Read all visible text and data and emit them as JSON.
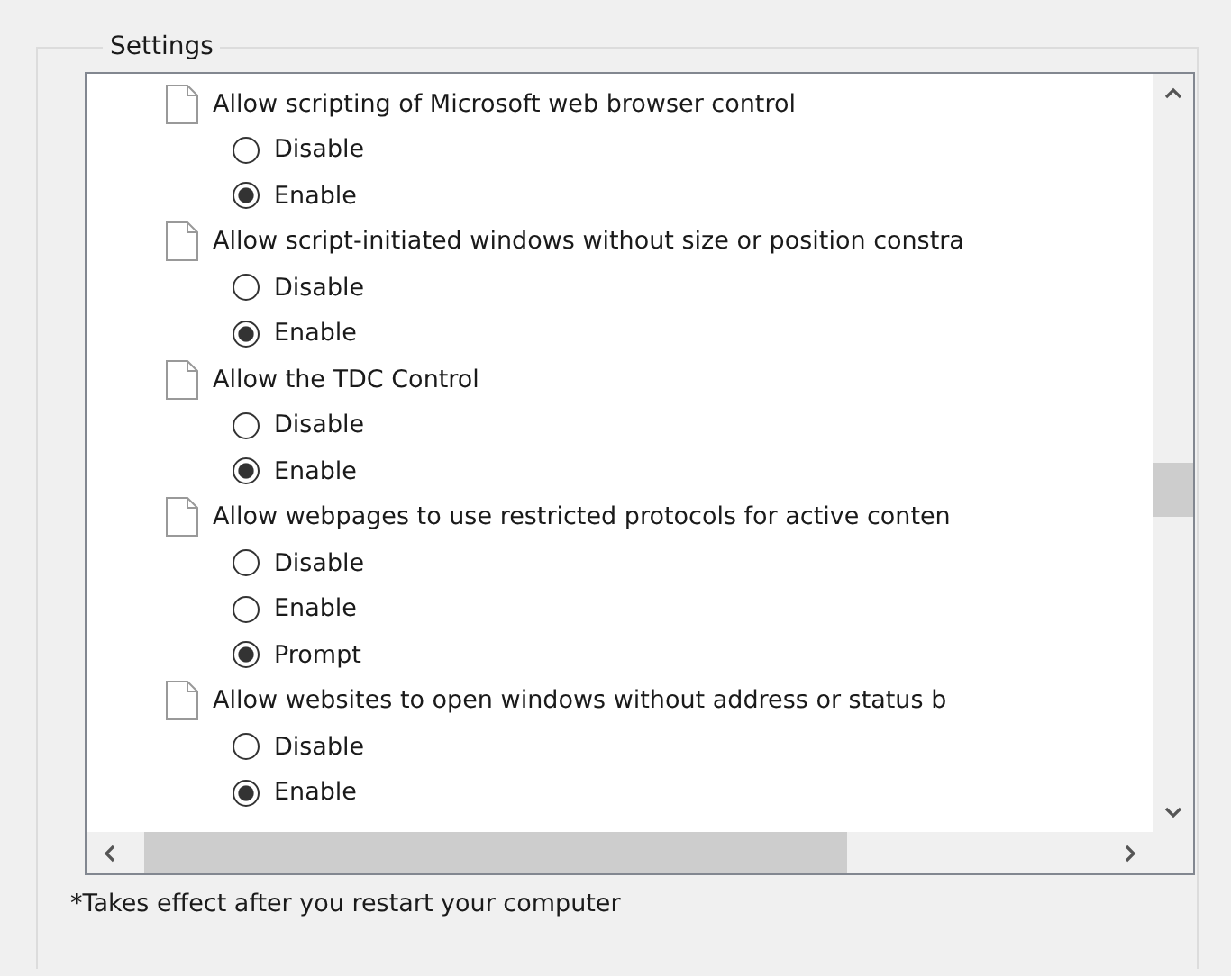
{
  "group": {
    "title": "Settings"
  },
  "settings": [
    {
      "label": "Allow scripting of Microsoft web browser control",
      "options": [
        {
          "label": "Disable",
          "selected": false
        },
        {
          "label": "Enable",
          "selected": true
        }
      ]
    },
    {
      "label": "Allow script-initiated windows without size or position constra",
      "options": [
        {
          "label": "Disable",
          "selected": false
        },
        {
          "label": "Enable",
          "selected": true
        }
      ]
    },
    {
      "label": "Allow the TDC Control",
      "options": [
        {
          "label": "Disable",
          "selected": false
        },
        {
          "label": "Enable",
          "selected": true
        }
      ]
    },
    {
      "label": "Allow webpages to use restricted protocols for active conten",
      "options": [
        {
          "label": "Disable",
          "selected": false
        },
        {
          "label": "Enable",
          "selected": false
        },
        {
          "label": "Prompt",
          "selected": true
        }
      ]
    },
    {
      "label": "Allow websites to open windows without address or status b",
      "options": [
        {
          "label": "Disable",
          "selected": false
        },
        {
          "label": "Enable",
          "selected": true
        }
      ]
    }
  ],
  "footnote": "*Takes effect after you restart your computer"
}
